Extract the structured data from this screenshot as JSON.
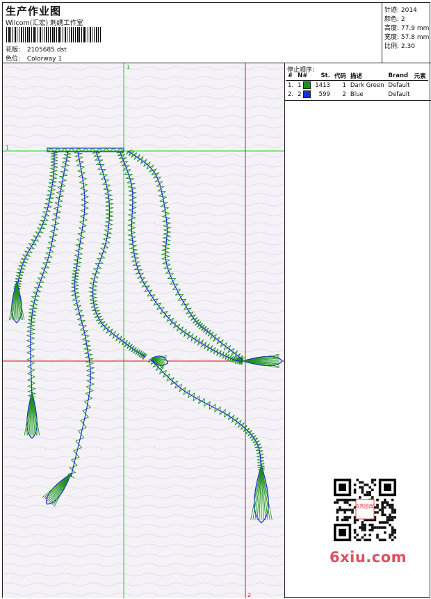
{
  "header": {
    "title": "生产作业图",
    "company": "Wilcom(汇宏) 刺绣工作室",
    "design_label": "花版:",
    "design_value": "2105685.dst",
    "colorway_label": "色位:",
    "colorway_value": "Colorway 1"
  },
  "stats": {
    "stitches_label": "针迹:",
    "stitches_value": "2014",
    "colors_label": "颜色:",
    "colors_value": "2",
    "height_label": "高度:",
    "height_value": "77.9 mm",
    "width_label": "宽度:",
    "width_value": "57.8 mm",
    "scale_label": "比例:",
    "scale_value": "2.30"
  },
  "stop_sequence": {
    "title": "停止顺序:",
    "columns": [
      "#",
      "N#",
      "St.",
      "代码",
      "描述",
      "Brand",
      "元素"
    ],
    "rows": [
      {
        "index": "1.",
        "needle": "1",
        "color": "#1a8f1a",
        "stitches": "1413",
        "code": "1",
        "description": "Dark Green",
        "brand": "Default"
      },
      {
        "index": "2.",
        "needle": "2",
        "color": "#1a2fd8",
        "stitches": "599",
        "code": "2",
        "description": "Blue",
        "brand": "Default"
      }
    ]
  },
  "guides": {
    "green_v_label": "1",
    "green_h_label": "1",
    "red_v_label": "2",
    "red_h_label": "2"
  },
  "colors": {
    "dark_green": "#1a8f1a",
    "blue": "#1a2fd8",
    "guide_green": "#22cc22",
    "guide_red": "#dd1111"
  },
  "watermark": {
    "text": "6xiu.com",
    "badge": "6秀图库"
  }
}
